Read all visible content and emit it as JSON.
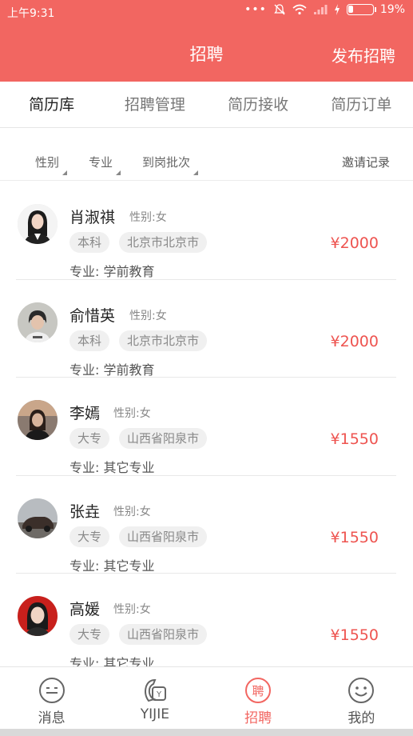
{
  "status": {
    "time": "上午9:31",
    "battery": "19%"
  },
  "header": {
    "title": "招聘",
    "action": "发布招聘"
  },
  "tabs": [
    {
      "label": "简历库",
      "active": true
    },
    {
      "label": "招聘管理",
      "active": false
    },
    {
      "label": "简历接收",
      "active": false
    },
    {
      "label": "简历订单",
      "active": false
    }
  ],
  "filters": {
    "gender": "性别",
    "major": "专业",
    "batch": "到岗批次",
    "invite": "邀请记录"
  },
  "candidates": [
    {
      "name": "肖淑祺",
      "gender": "性别:女",
      "education": "本科",
      "location": "北京市北京市",
      "major": "专业: 学前教育",
      "price": "¥2000"
    },
    {
      "name": "俞惜英",
      "gender": "性别:女",
      "education": "本科",
      "location": "北京市北京市",
      "major": "专业: 学前教育",
      "price": "¥2000"
    },
    {
      "name": "李嫣",
      "gender": "性别:女",
      "education": "大专",
      "location": "山西省阳泉市",
      "major": "专业: 其它专业",
      "price": "¥1550"
    },
    {
      "name": "张垚",
      "gender": "性别:女",
      "education": "大专",
      "location": "山西省阳泉市",
      "major": "专业: 其它专业",
      "price": "¥1550"
    },
    {
      "name": "高媛",
      "gender": "性别:女",
      "education": "大专",
      "location": "山西省阳泉市",
      "major": "专业: 其它专业",
      "price": "¥1550"
    }
  ],
  "bottom_nav": [
    {
      "label": "消息",
      "icon": "message-icon"
    },
    {
      "label": "YIJIE",
      "icon": "yijie-logo-icon"
    },
    {
      "label": "招聘",
      "icon": "recruit-icon",
      "icon_text": "聘",
      "active": true
    },
    {
      "label": "我的",
      "icon": "smiley-profile-icon"
    }
  ],
  "colors": {
    "brand": "#f26661",
    "price": "#ee5450"
  }
}
